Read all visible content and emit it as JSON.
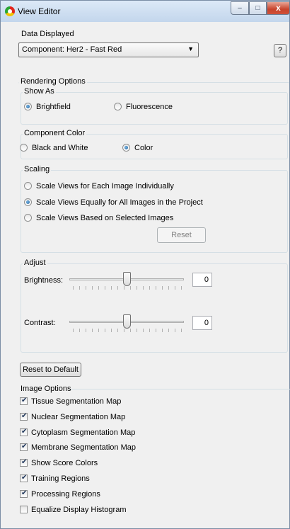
{
  "window": {
    "title": "View Editor",
    "min_glyph": "–",
    "max_glyph": "□",
    "close_glyph": "x"
  },
  "data_displayed": {
    "label": "Data Displayed",
    "selected": "Component: Her2 - Fast Red",
    "help_label": "?"
  },
  "rendering": {
    "label": "Rendering Options",
    "show_as": {
      "label": "Show As",
      "options": [
        {
          "label": "Brightfield",
          "selected": true
        },
        {
          "label": "Fluorescence",
          "selected": false
        }
      ]
    },
    "component_color": {
      "label": "Component Color",
      "options": [
        {
          "label": "Black and White",
          "selected": false
        },
        {
          "label": "Color",
          "selected": true
        }
      ]
    },
    "scaling": {
      "label": "Scaling",
      "options": [
        {
          "label": "Scale Views for Each Image Individually",
          "selected": false
        },
        {
          "label": "Scale Views Equally for All Images in the Project",
          "selected": true
        },
        {
          "label": "Scale Views Based on Selected Images",
          "selected": false
        }
      ],
      "reset_label": "Reset"
    },
    "adjust": {
      "label": "Adjust",
      "brightness": {
        "label": "Brightness:",
        "value": "0",
        "position": 0.5
      },
      "contrast": {
        "label": "Contrast:",
        "value": "0",
        "position": 0.5
      }
    },
    "reset_default_label": "Reset to Default"
  },
  "image_options": {
    "label": "Image Options",
    "items": [
      {
        "label": "Tissue Segmentation Map",
        "checked": true
      },
      {
        "label": "Nuclear Segmentation Map",
        "checked": true
      },
      {
        "label": "Cytoplasm Segmentation Map",
        "checked": true
      },
      {
        "label": "Membrane Segmentation Map",
        "checked": true
      },
      {
        "label": "Show Score Colors",
        "checked": true
      },
      {
        "label": "Training Regions",
        "checked": true
      },
      {
        "label": "Processing Regions",
        "checked": true
      },
      {
        "label": "Equalize Display Histogram",
        "checked": false
      }
    ]
  }
}
